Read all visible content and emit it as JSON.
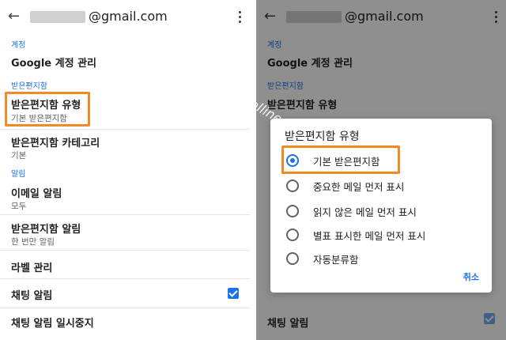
{
  "left": {
    "email": "@gmail.com",
    "sections": {
      "account": "계정",
      "inbox": "받은편지함",
      "alerts": "알림"
    },
    "items": [
      {
        "title": "Google 계정 관리"
      },
      {
        "title": "받은편지함 유형",
        "sub": "기본 받은편지함"
      },
      {
        "title": "받은편지함 카테고리",
        "sub": "기본"
      },
      {
        "title": "이메일 알림",
        "sub": "모두"
      },
      {
        "title": "받은편지함 알림",
        "sub": "한 번만 알림"
      },
      {
        "title": "라벨 관리"
      },
      {
        "title": "채팅 알림"
      },
      {
        "title": "채팅 알림 일시중지"
      }
    ]
  },
  "right": {
    "email": "@gmail.com",
    "sections": {
      "account": "계정",
      "inbox": "받은편지함"
    },
    "background_items": [
      {
        "title": "Google 계정 관리"
      },
      {
        "title": "받은편지함 유형"
      },
      {
        "title": "채팅 알림"
      }
    ],
    "watermark": "digitalline",
    "dialog": {
      "title": "받은편지함 유형",
      "options": [
        "기본 받은편지함",
        "중요한 메일 먼저 표시",
        "읽지 않은 메일 먼저 표시",
        "별표 표시한 메일 먼저 표시",
        "자동분류함"
      ],
      "selected_index": 0,
      "cancel": "취소"
    }
  },
  "colors": {
    "accent": "#1a73e8",
    "highlight": "#f08a24"
  }
}
